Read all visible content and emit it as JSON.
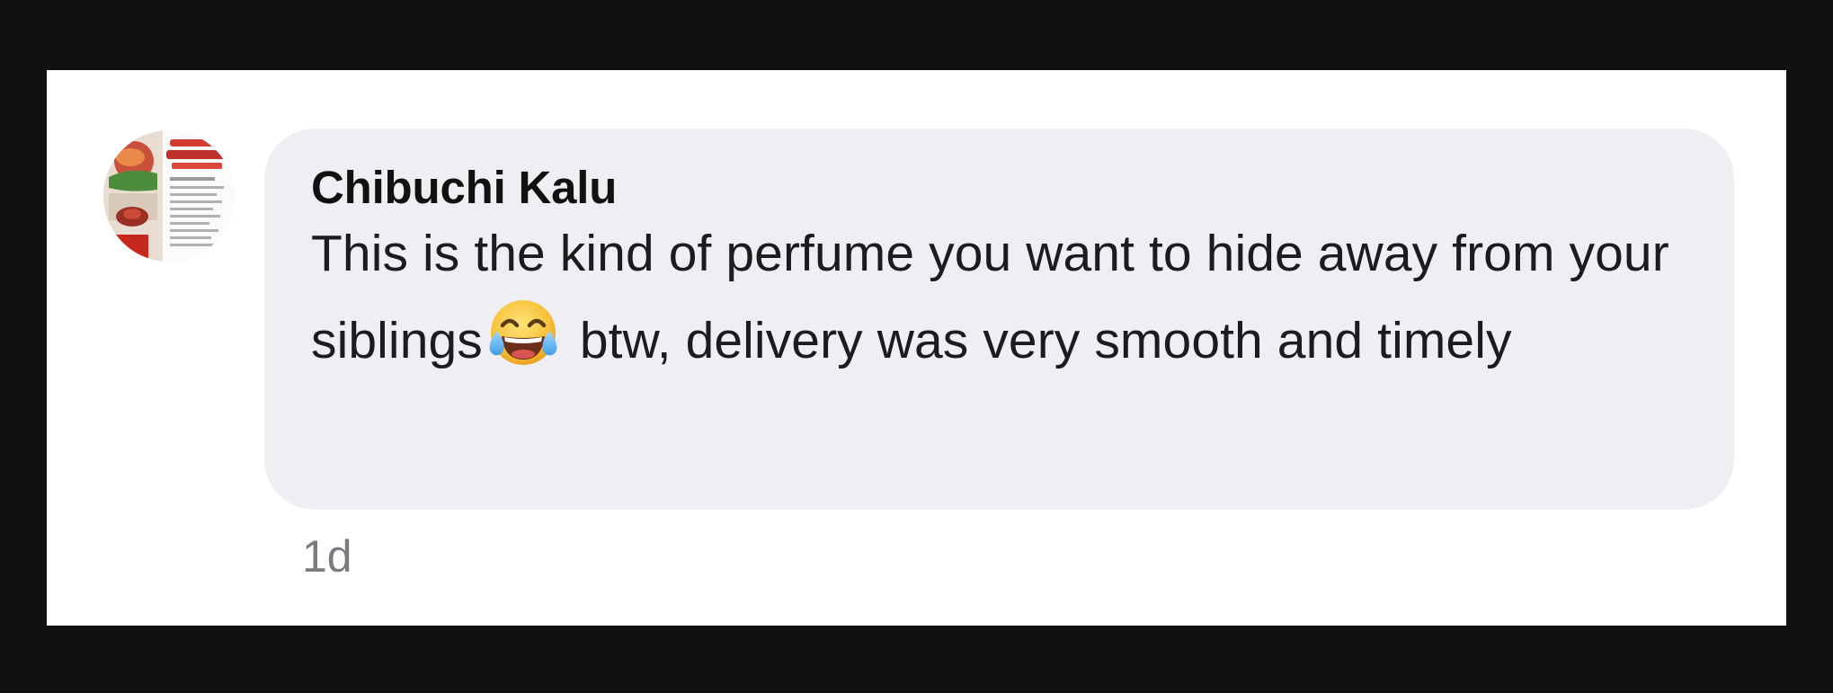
{
  "comment": {
    "author": "Chibuchi Kalu",
    "text_part1": "This is the kind of perfume you want to hide away from your siblings",
    "emoji": "face-with-tears-of-joy-icon",
    "text_part2": " btw, delivery was very smooth and timely",
    "timestamp": "1d"
  },
  "colors": {
    "frame_background": "#111111",
    "card_background": "#ffffff",
    "bubble_background": "#efeff3",
    "author_color": "#111111",
    "text_color": "#1c1c1e",
    "timestamp_color": "#7a7a80"
  }
}
